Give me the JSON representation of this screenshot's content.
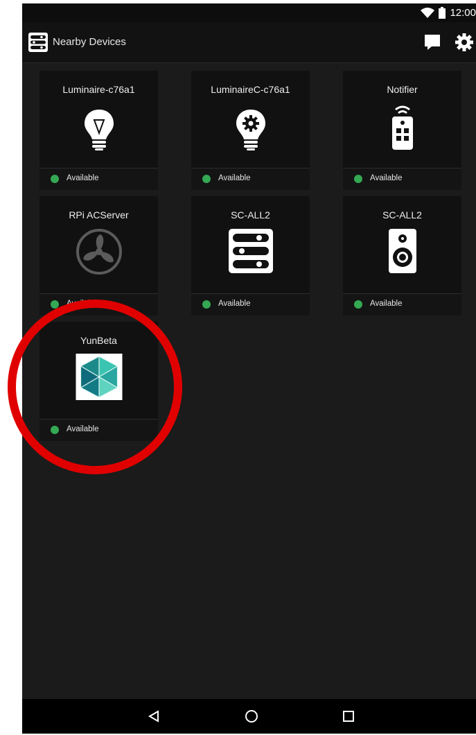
{
  "statusbar": {
    "time": "12:00"
  },
  "appbar": {
    "title": "Nearby Devices"
  },
  "devices": [
    {
      "name": "Luminaire-c76a1",
      "icon": "lightbulb-icon",
      "status": "Available"
    },
    {
      "name": "LuminaireC-c76a1",
      "icon": "lightbulb-gear-icon",
      "status": "Available"
    },
    {
      "name": "Notifier",
      "icon": "remote-control-icon",
      "status": "Available"
    },
    {
      "name": "RPi ACServer",
      "icon": "fan-icon",
      "status": "Available"
    },
    {
      "name": "SC-ALL2",
      "icon": "server-toggles-icon",
      "status": "Available"
    },
    {
      "name": "SC-ALL2",
      "icon": "speaker-icon",
      "status": "Available"
    },
    {
      "name": "YunBeta",
      "icon": "geometric-logo-icon",
      "status": "Available"
    }
  ],
  "colors": {
    "available": "#34a853",
    "highlight": "#e00000",
    "background": "#1b1b1b"
  }
}
